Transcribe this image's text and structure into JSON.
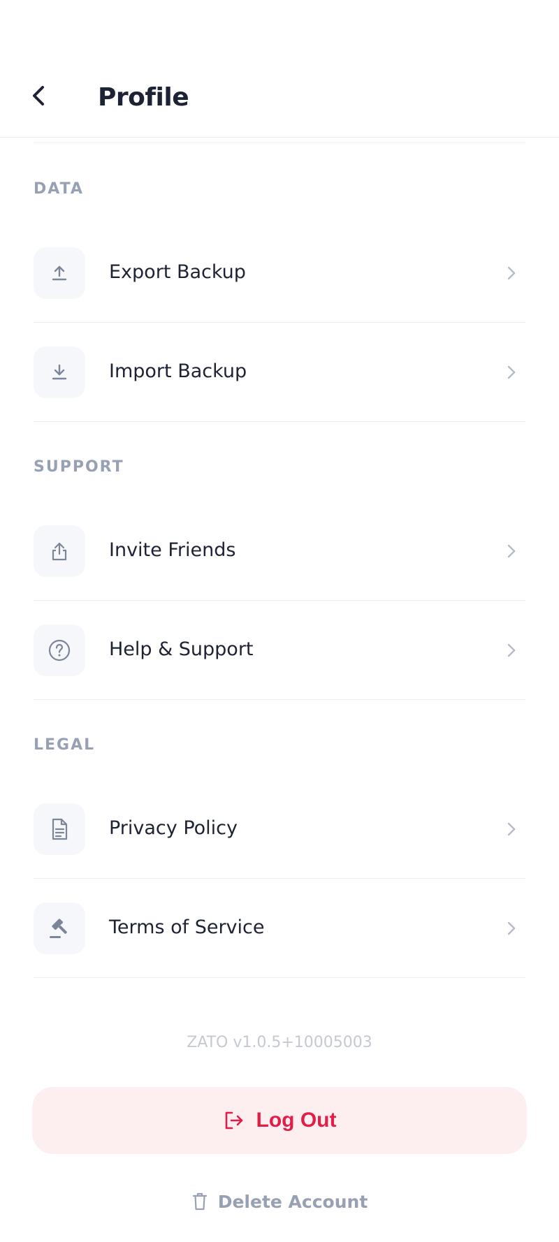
{
  "header": {
    "title": "Profile",
    "back_icon": "chevron-left-icon"
  },
  "sections": [
    {
      "label": "DATA",
      "items": [
        {
          "label": "Export Backup",
          "icon": "upload-icon"
        },
        {
          "label": "Import Backup",
          "icon": "download-icon"
        }
      ]
    },
    {
      "label": "SUPPORT",
      "items": [
        {
          "label": "Invite Friends",
          "icon": "share-icon"
        },
        {
          "label": "Help & Support",
          "icon": "help-circle-icon"
        }
      ]
    },
    {
      "label": "LEGAL",
      "items": [
        {
          "label": "Privacy Policy",
          "icon": "document-icon"
        },
        {
          "label": "Terms of Service",
          "icon": "gavel-icon"
        }
      ]
    }
  ],
  "footer": {
    "version": "ZATO v1.0.5+10005003",
    "logout_label": "Log Out",
    "delete_label": "Delete Account"
  },
  "colors": {
    "primary_text": "#1e2235",
    "muted_text": "#98a1b3",
    "danger": "#e11d48",
    "danger_bg": "#fdeff0",
    "icon_bg": "#f5f7fa"
  }
}
